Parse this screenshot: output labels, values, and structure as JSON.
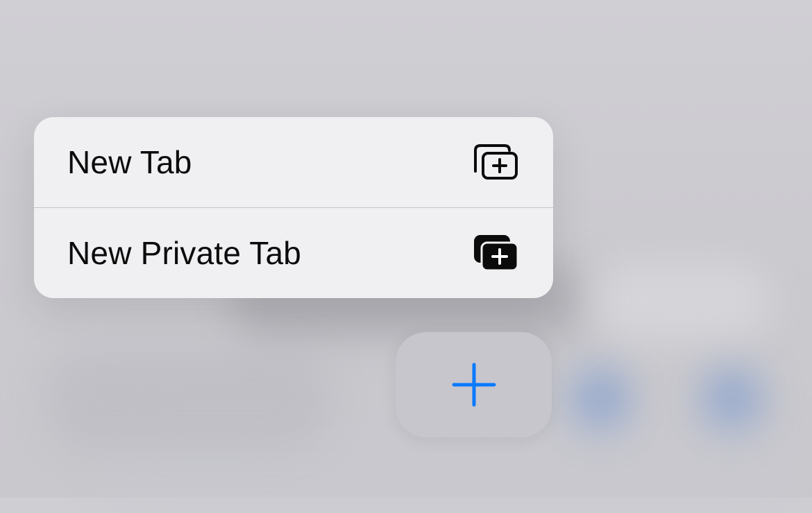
{
  "menu": {
    "items": [
      {
        "label": "New Tab",
        "icon": "new-tab-icon"
      },
      {
        "label": "New Private Tab",
        "icon": "new-private-tab-icon"
      }
    ]
  },
  "add_button": {
    "icon": "plus-icon",
    "accent_color": "#0a7aff"
  }
}
